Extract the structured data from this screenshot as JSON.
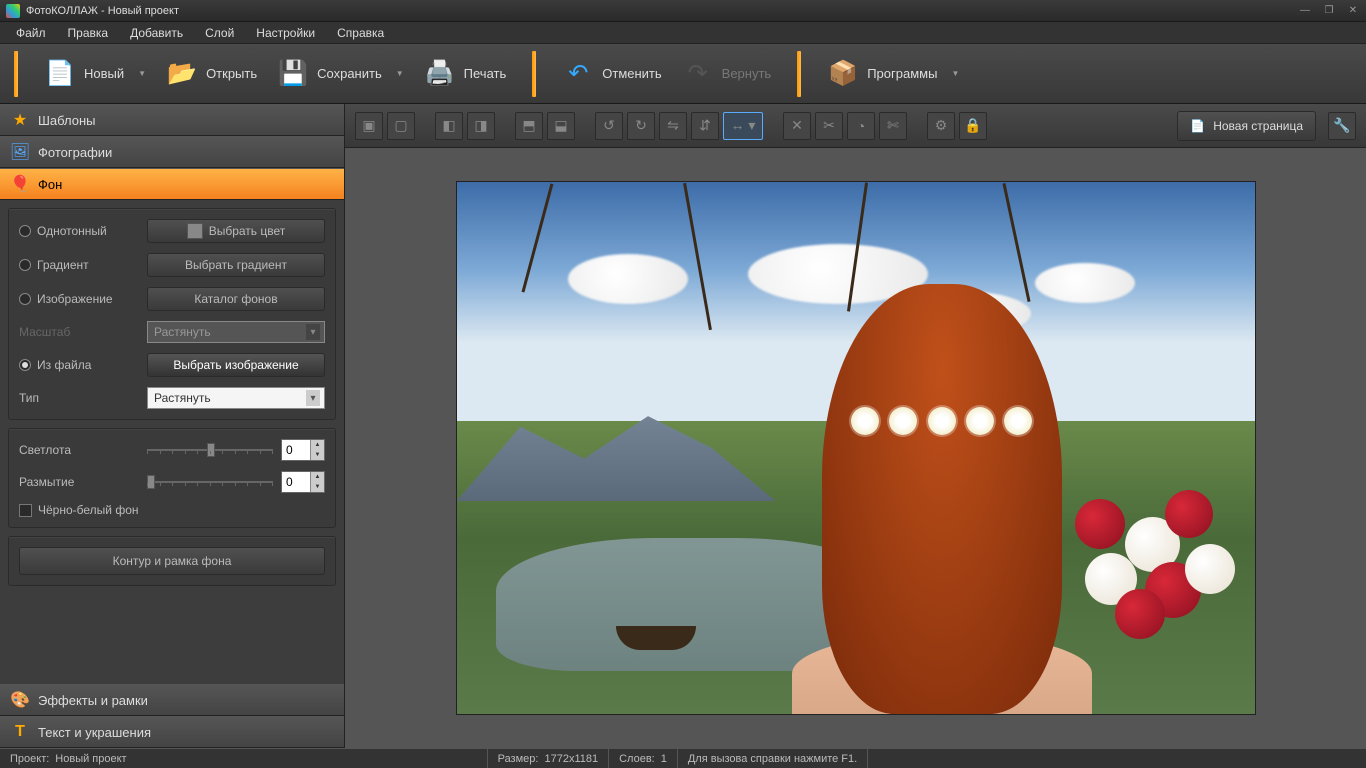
{
  "title": "ФотоКОЛЛАЖ - Новый проект",
  "menu": [
    "Файл",
    "Правка",
    "Добавить",
    "Слой",
    "Настройки",
    "Справка"
  ],
  "toolbar": {
    "new": "Новый",
    "open": "Открыть",
    "save": "Сохранить",
    "print": "Печать",
    "undo": "Отменить",
    "redo": "Вернуть",
    "programs": "Программы"
  },
  "sidebar": {
    "templates": "Шаблоны",
    "photos": "Фотографии",
    "background": "Фон",
    "effects": "Эффекты и рамки",
    "text": "Текст и украшения"
  },
  "bg_panel": {
    "solid": "Однотонный",
    "choose_color": "Выбрать цвет",
    "gradient": "Градиент",
    "choose_gradient": "Выбрать градиент",
    "image": "Изображение",
    "catalog": "Каталог фонов",
    "scale": "Масштаб",
    "stretch": "Растянуть",
    "from_file": "Из файла",
    "choose_image": "Выбрать изображение",
    "type": "Тип",
    "type_val": "Растянуть",
    "brightness": "Светлота",
    "brightness_val": "0",
    "blur": "Размытие",
    "blur_val": "0",
    "grayscale": "Чёрно-белый фон",
    "contour": "Контур и рамка фона"
  },
  "canvas_toolbar": {
    "new_page": "Новая страница"
  },
  "status": {
    "project_label": "Проект:",
    "project": "Новый проект",
    "size_label": "Размер:",
    "size": "1772x1181",
    "layers_label": "Слоев:",
    "layers": "1",
    "help": "Для вызова справки нажмите F1."
  }
}
